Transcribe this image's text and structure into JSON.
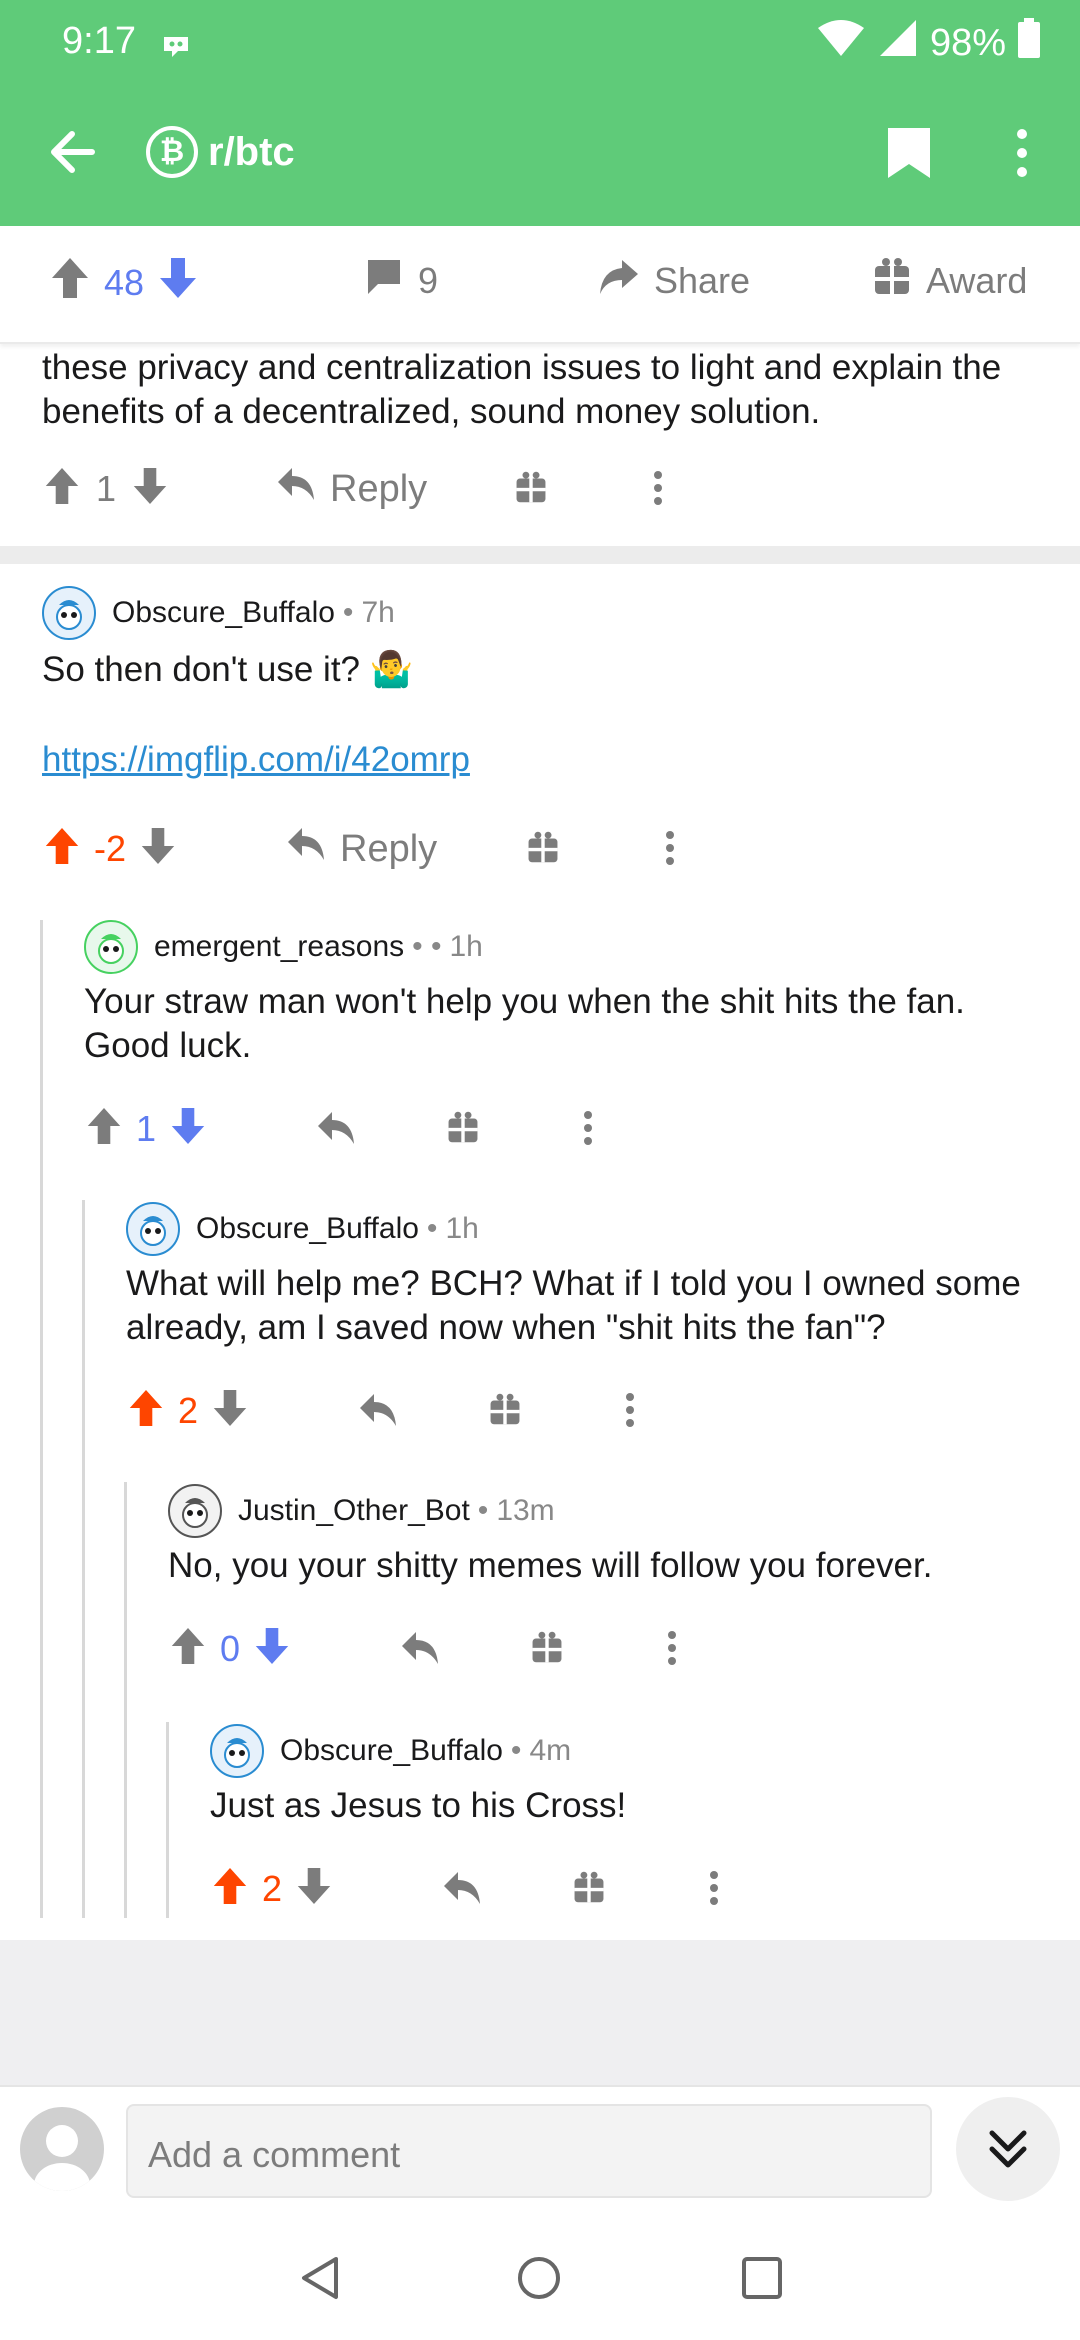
{
  "status": {
    "time": "9:17",
    "battery": "98%"
  },
  "header": {
    "subreddit": "r/btc",
    "coin_symbol": "₿"
  },
  "post_actions": {
    "votes": "48",
    "comments": "9",
    "share": "Share",
    "award": "Award"
  },
  "prev_comment": {
    "text": "these privacy and centralization issues to light and explain the benefits of a decentralized, sound money solution.",
    "votes": "1",
    "reply": "Reply"
  },
  "comments": [
    {
      "author": "Obscure_Buffalo",
      "age": "7h",
      "text": "So then don't use it? 🤷‍♂️",
      "link": "https://imgflip.com/i/42omrp",
      "votes": "-2",
      "reply": "Reply"
    },
    {
      "author": "emergent_reasons",
      "age": "1h",
      "text": "Your straw man won't help you when the shit hits the fan. Good luck.",
      "votes": "1"
    },
    {
      "author": "Obscure_Buffalo",
      "age": "1h",
      "text": "What will help me? BCH? What if I told you I owned some already, am I saved now when \"shit hits the fan\"?",
      "votes": "2"
    },
    {
      "author": "Justin_Other_Bot",
      "age": "13m",
      "text": "No, you your shitty memes will follow you forever.",
      "votes": "0"
    },
    {
      "author": "Obscure_Buffalo",
      "age": "4m",
      "text": "Just as Jesus to his Cross!",
      "votes": "2"
    }
  ],
  "compose": {
    "placeholder": "Add a comment"
  },
  "colors": {
    "header": "#5fcb79",
    "upvote": "#fe4500",
    "downvote": "#5e7cf0",
    "icon_gray": "#7c7c7c"
  }
}
